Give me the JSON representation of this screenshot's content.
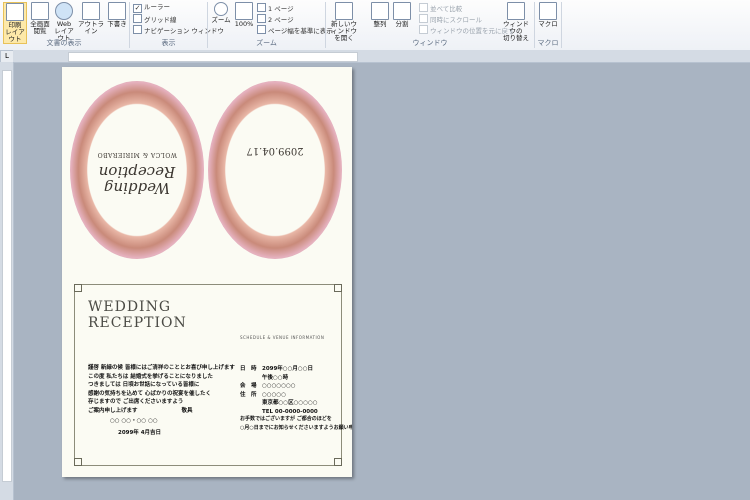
{
  "ribbon": {
    "doc_view": {
      "print_layout": "印刷\nレイアウト",
      "fullscreen": "全画面\n閲覧",
      "web_layout": "Web\nレイアウト",
      "outline": "アウトライン",
      "draft": "下書き",
      "group_label": "文書の表示"
    },
    "show": {
      "ruler": "ルーラー",
      "gridlines": "グリッド線",
      "navigation": "ナビゲーション ウィンドウ",
      "group_label": "表示"
    },
    "zoom": {
      "zoom": "ズーム",
      "percent": "100%",
      "one_page": "1 ページ",
      "two_pages": "2 ページ",
      "page_width": "ページ幅を基準に表示",
      "group_label": "ズーム"
    },
    "window": {
      "new_window": "新しいウィンドウ\nを開く",
      "arrange": "整列",
      "split": "分割",
      "side_by_side": "並べて比較",
      "sync_scroll": "同時にスクロール",
      "reset_position": "ウィンドウの位置を元に戻す",
      "switch_windows": "ウィンドウの\n切り替え",
      "group_label": "ウィンドウ"
    },
    "macro": {
      "macro": "マクロ",
      "group_label": "マクロ"
    }
  },
  "document": {
    "date": "2099.04.17",
    "script_title": "Wedding Reception",
    "couple": "WOLCA & MIRIERABO",
    "title": "WEDDING\nRECEPTION",
    "schedule_heading": "SCHEDULE & VENUE INFORMATION",
    "message_lines": [
      "謹啓 新緑の候 皆様にはご清祥のこととお喜び申し上げます",
      "この度 私たちは 結婚式を挙げることになりました",
      "つきましては 日頃お世話になっている皆様に",
      "感謝の気持ちを込めて 心ばかりの祝宴を催したく",
      "存じますので ご出席くださいますよう",
      "ご案内申し上げます　　　　　　　　敬具"
    ],
    "names_line": "○○ ○○・○○ ○○",
    "date_line": "2099年 4月吉日",
    "info_lines": [
      "日　時　2099年○○月○○日",
      "　　　　午後○○時",
      "会　場　○○○○○○○",
      "住　所　○○○○○",
      "　　　　東京都○○区○○○○○",
      "　　　　TEL 00-0000-0000"
    ],
    "reply_lines": [
      "お手数ではございますが ご都合のほどを",
      "○月○日までにお知らせくださいますようお願い申し上げます"
    ]
  }
}
